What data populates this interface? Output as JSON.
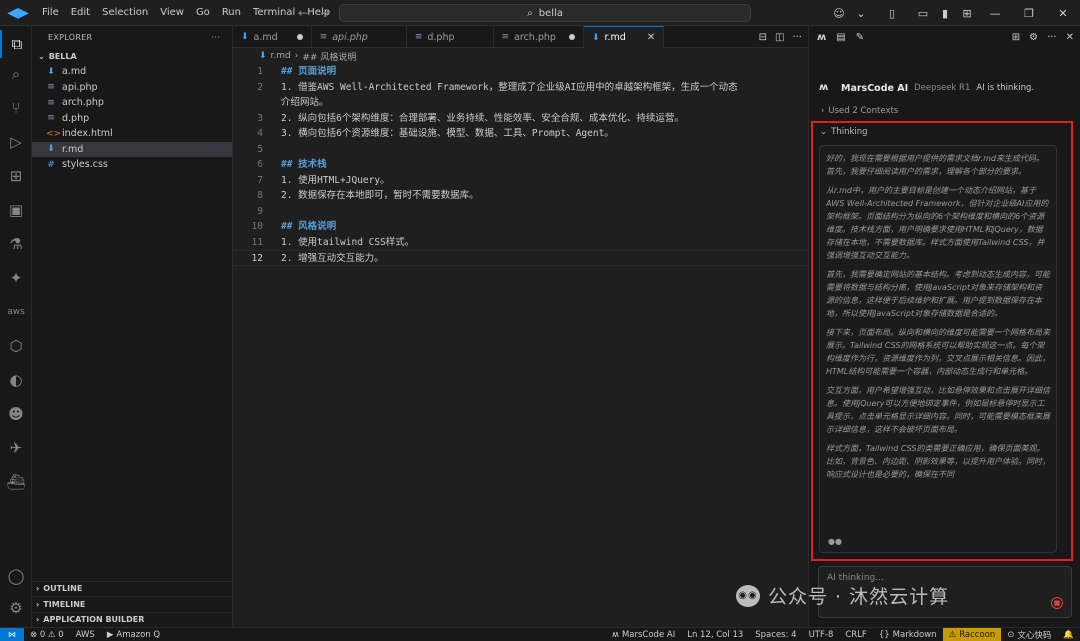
{
  "menu": [
    "File",
    "Edit",
    "Selection",
    "View",
    "Go",
    "Run",
    "Terminal",
    "Help"
  ],
  "search": {
    "text": "bella"
  },
  "explorer": {
    "title": "EXPLORER",
    "folder": "BELLA",
    "files": [
      {
        "name": "a.md",
        "icon": "markdown-icon"
      },
      {
        "name": "api.php",
        "icon": "php-icon"
      },
      {
        "name": "arch.php",
        "icon": "php-icon"
      },
      {
        "name": "d.php",
        "icon": "php-icon"
      },
      {
        "name": "index.html",
        "icon": "html-icon"
      },
      {
        "name": "r.md",
        "icon": "markdown-icon"
      },
      {
        "name": "styles.css",
        "icon": "css-icon"
      }
    ],
    "sections": [
      "OUTLINE",
      "TIMELINE",
      "APPLICATION BUILDER"
    ]
  },
  "tabs": [
    {
      "name": "a.md",
      "modified": true
    },
    {
      "name": "api.php",
      "modified": false
    },
    {
      "name": "d.php",
      "modified": false
    },
    {
      "name": "arch.php",
      "modified": true
    },
    {
      "name": "r.md",
      "active": true
    }
  ],
  "breadcrumb": {
    "file": "r.md",
    "section": "## 风格说明"
  },
  "editor_lines": [
    {
      "n": "1",
      "text": "## 页面说明",
      "heading": true
    },
    {
      "n": "2",
      "text": "1. 借鉴AWS Well-Architected Framework，整理成了企业级AI应用中的卓越架构框架，生成一个动态"
    },
    {
      "n": "",
      "text": "介绍网站。"
    },
    {
      "n": "3",
      "text": "2. 纵向包括6个架构维度：合理部署、业务持续、性能效率、安全合规、成本优化、持续运营。"
    },
    {
      "n": "4",
      "text": "3. 横向包括6个资源维度：基础设施、模型、数据、工具、Prompt、Agent。"
    },
    {
      "n": "5",
      "text": ""
    },
    {
      "n": "6",
      "text": "## 技术栈",
      "heading": true
    },
    {
      "n": "7",
      "text": "1. 使用HTML+JQuery。"
    },
    {
      "n": "8",
      "text": "2. 数据保存在本地即可，暂时不需要数据库。"
    },
    {
      "n": "9",
      "text": ""
    },
    {
      "n": "10",
      "text": "## 风格说明",
      "heading": true
    },
    {
      "n": "11",
      "text": "1. 使用tailwind CSS样式。"
    },
    {
      "n": "12",
      "text": "2. 增强互动交互能力。",
      "current": true
    }
  ],
  "assistant": {
    "name": "MarsCode AI",
    "model": "Deepseek R1",
    "status": "AI is thinking.",
    "context": "Used 2 Contexts",
    "thinking_label": "Thinking",
    "paragraphs": [
      "好的，我现在需要根据用户提供的需求文档r.md来生成代码。首先，我要仔细阅读用户的需求，理解各个部分的要求。",
      "从r.md中，用户的主要目标是创建一个动态介绍网站，基于AWS Well-Architected Framework，但针对企业级AI应用的架构框架。页面结构分为纵向的6个架构维度和横向的6个资源维度。技术栈方面，用户明确要求使用HTML和jQuery，数据存储在本地，不需要数据库。样式方面使用Tailwind CSS，并强调增强互动交互能力。",
      "首先，我需要确定网站的基本结构。考虑到动态生成内容，可能需要将数据与结构分离，使用JavaScript对象来存储架构和资源的信息，这样便于后续维护和扩展。用户提到数据保存在本地，所以使用JavaScript对象存储数据是合适的。",
      "接下来，页面布局。纵向和横向的维度可能需要一个网格布局来展示。Tailwind CSS的网格系统可以帮助实现这一点。每个架构维度作为行，资源维度作为列，交叉点展示相关信息。因此，HTML结构可能需要一个容器，内部动态生成行和单元格。",
      "交互方面，用户希望增强互动，比如悬停效果和点击展开详细信息。使用jQuery可以方便地绑定事件，例如鼠标悬停时显示工具提示，点击单元格显示详细内容。同时，可能需要模态框来展示详细信息，这样不会破坏页面布局。",
      "样式方面，Tailwind CSS的类需要正确应用，确保页面美观。比如，背景色、内边距、阴影效果等，以提升用户体验。同时，响应式设计也是必要的，确保在不同"
    ],
    "input_placeholder": "AI thinking...",
    "watermark": "公众号 · 沐然云计算"
  },
  "statusbar": {
    "problems": "⊗ 0 ⚠ 0",
    "aws": "AWS",
    "amazonq": "Amazon Q",
    "marscode": "MarsCode AI",
    "position": "Ln 12, Col 13",
    "spaces": "Spaces: 4",
    "encoding": "UTF-8",
    "eol": "CRLF",
    "language": "Markdown",
    "raccoon": "Raccoon",
    "wenxin": "文心快码"
  }
}
